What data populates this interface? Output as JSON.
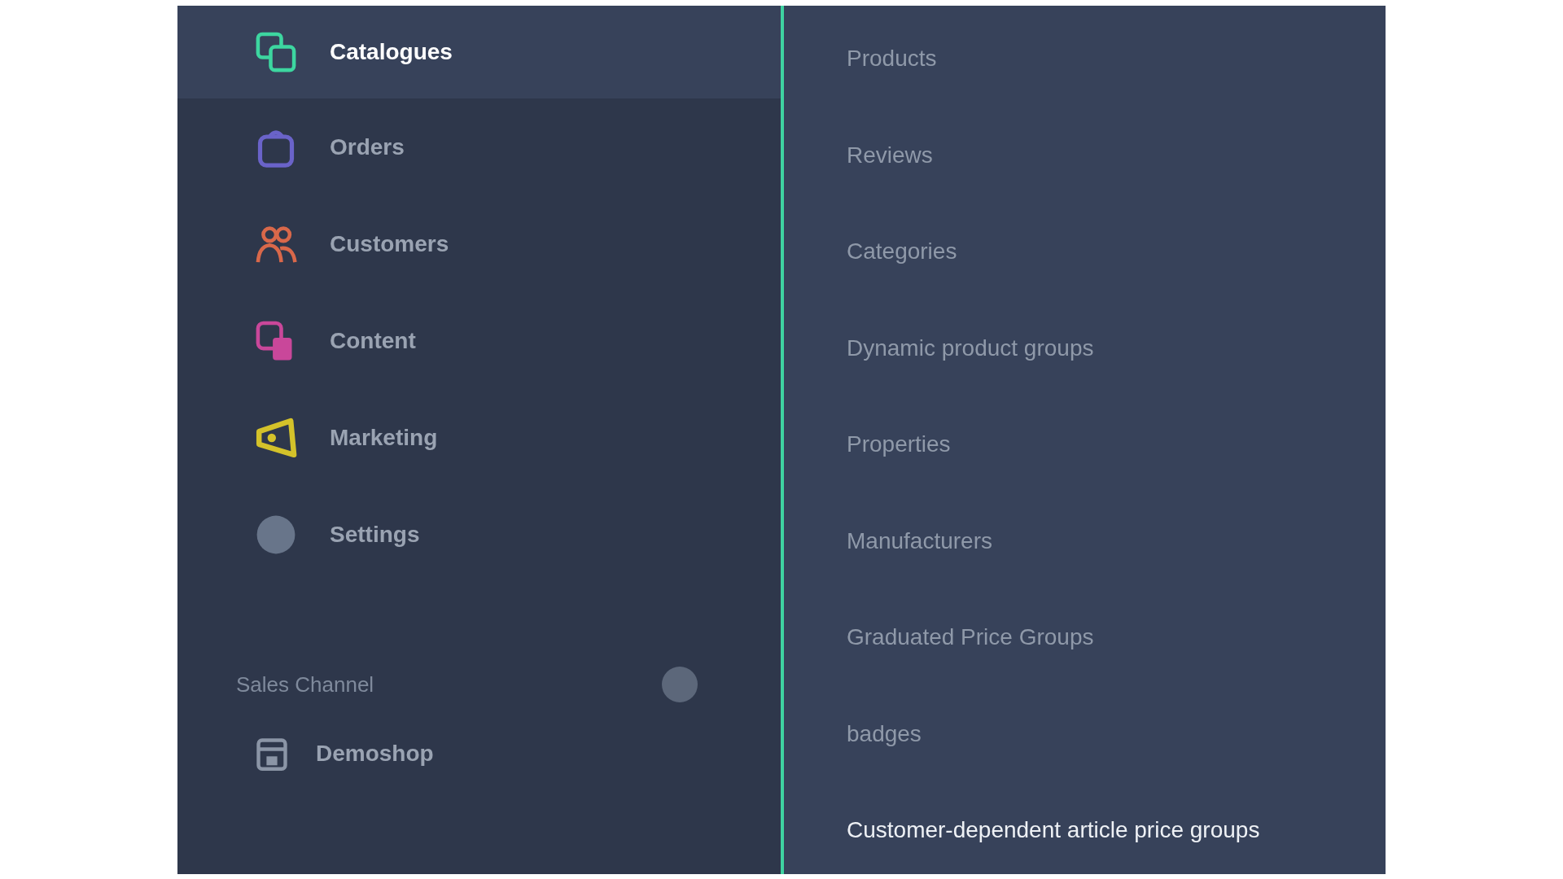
{
  "main_menu": [
    {
      "label": "Catalogues",
      "kind": "catalogue",
      "color": "#3dd6a0",
      "selected": true
    },
    {
      "label": "Orders",
      "kind": "bag",
      "color": "#6a63c9",
      "selected": false
    },
    {
      "label": "Customers",
      "kind": "people",
      "color": "#d9684a",
      "selected": false
    },
    {
      "label": "Content",
      "kind": "content",
      "color": "#c9479a",
      "selected": false
    },
    {
      "label": "Marketing",
      "kind": "megaphone",
      "color": "#d4c22a",
      "selected": false
    },
    {
      "label": "Settings",
      "kind": "circle",
      "color": "#68758a",
      "selected": false
    }
  ],
  "sales_channel": {
    "heading": "Sales Channel",
    "items": [
      {
        "label": "Demoshop"
      }
    ]
  },
  "submenu": [
    {
      "label": "Products",
      "selected": false
    },
    {
      "label": "Reviews",
      "selected": false
    },
    {
      "label": "Categories",
      "selected": false
    },
    {
      "label": "Dynamic product groups",
      "selected": false
    },
    {
      "label": "Properties",
      "selected": false
    },
    {
      "label": "Manufacturers",
      "selected": false
    },
    {
      "label": "Graduated Price Groups",
      "selected": false
    },
    {
      "label": "badges",
      "selected": false
    },
    {
      "label": "Customer-dependent article price groups",
      "selected": true
    }
  ]
}
